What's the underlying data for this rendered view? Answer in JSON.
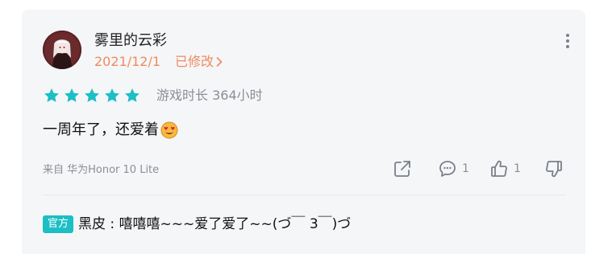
{
  "review": {
    "user": {
      "name": "雾里的云彩"
    },
    "date": "2021/12/1",
    "edited_label": "已修改",
    "rating": 5,
    "rating_max": 5,
    "playtime": "游戏时长 364小时",
    "content": "一周年了，还爱着",
    "device": "来自 华为Honor 10 Lite",
    "actions": {
      "comments_count": "1",
      "likes_count": "1"
    },
    "official_reply": {
      "badge": "官方",
      "author": "黑皮",
      "separator": " : ",
      "text": "嘻嘻嘻~~~爱了爱了~~(づ￣ 3￣)づ"
    }
  },
  "colors": {
    "star": "#1cbfc4",
    "accent_orange": "#f08a5d",
    "badge_bg": "#1cbfc4",
    "muted_text": "#8a8e96",
    "card_bg": "#f5f6f8"
  },
  "icons": {
    "avatar": "user-avatar-image",
    "more": "more-vertical-icon",
    "share": "share-icon",
    "comment": "comment-icon",
    "like": "thumbs-up-icon",
    "dislike": "thumbs-down-icon",
    "emoji": "heart-eyes-emoji"
  }
}
